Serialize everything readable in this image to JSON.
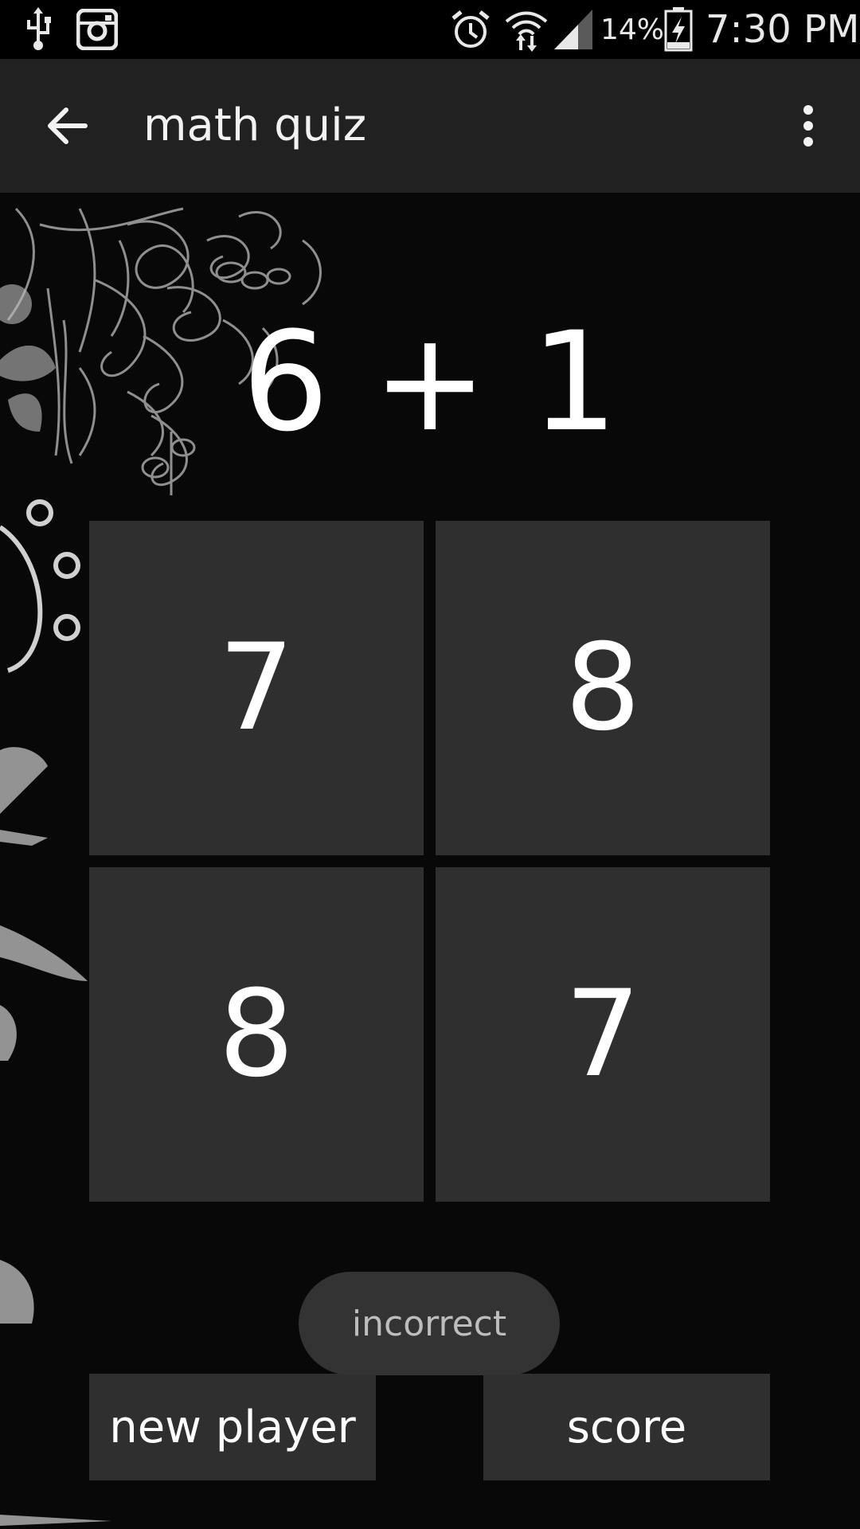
{
  "status_bar": {
    "usb_icon": "usb-icon",
    "instagram_icon": "instagram-icon",
    "alarm_icon": "alarm-icon",
    "wifi_icon": "wifi-icon",
    "signal_icon": "signal-icon",
    "battery_percent": "14%",
    "battery_icon": "battery-charging-icon",
    "time": "7:30 PM"
  },
  "app_bar": {
    "back_icon": "arrow-back-icon",
    "title": "math quiz",
    "overflow_icon": "more-vertical-icon",
    "background_color": "#212121"
  },
  "question": {
    "text": "6 + 1"
  },
  "answers": [
    {
      "label": "7"
    },
    {
      "label": "8"
    },
    {
      "label": "8"
    },
    {
      "label": "7"
    }
  ],
  "toast": {
    "text": "incorrect"
  },
  "buttons": {
    "new_player": "new player",
    "score": "score"
  },
  "colors": {
    "tile": "#2f2f2f",
    "background": "#080808",
    "toast": "#333333"
  }
}
